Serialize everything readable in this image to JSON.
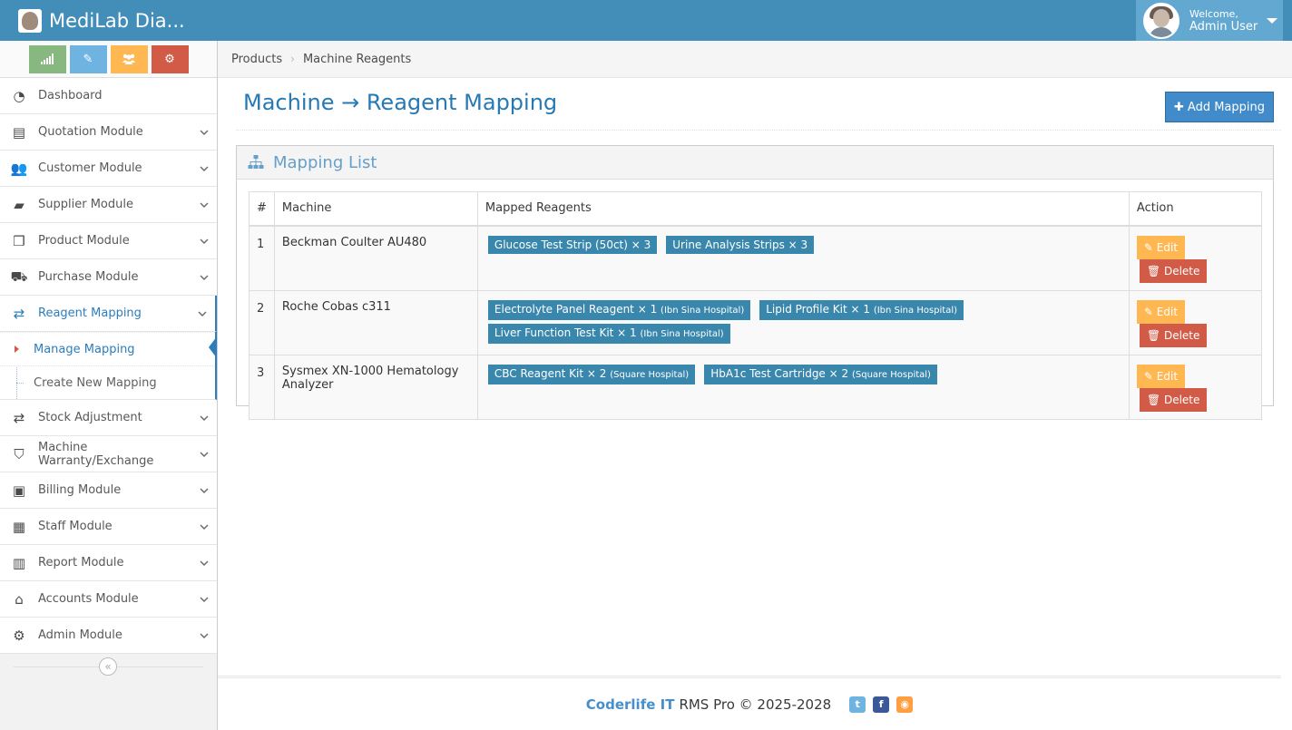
{
  "app": {
    "brand": "MediLab Dia..."
  },
  "user": {
    "welcome": "Welcome,",
    "name": "Admin User"
  },
  "colors": {
    "accent": "#438eb9",
    "link": "#2b7dbc",
    "badge": "#3a87ad",
    "edit": "#ffb752",
    "delete": "#d15b47"
  },
  "shortcuts": [
    "signal-icon",
    "pencil-icon",
    "users-icon",
    "cogs-icon"
  ],
  "sidebar": {
    "items": [
      {
        "label": "Dashboard",
        "icon": "tachometer-icon"
      },
      {
        "label": "Quotation Module",
        "icon": "file-text-icon"
      },
      {
        "label": "Customer Module",
        "icon": "users-icon"
      },
      {
        "label": "Supplier Module",
        "icon": "truck-icon"
      },
      {
        "label": "Product Module",
        "icon": "cubes-icon"
      },
      {
        "label": "Purchase Module",
        "icon": "cart-icon"
      },
      {
        "label": "Reagent Mapping",
        "icon": "exchange-icon"
      },
      {
        "label": "Stock Adjustment",
        "icon": "exchange-icon"
      },
      {
        "label": "Machine Warranty/Exchange",
        "icon": "shield-icon"
      },
      {
        "label": "Billing Module",
        "icon": "money-icon"
      },
      {
        "label": "Staff Module",
        "icon": "briefcase-icon"
      },
      {
        "label": "Report Module",
        "icon": "bar-chart-icon"
      },
      {
        "label": "Accounts Module",
        "icon": "bank-icon"
      },
      {
        "label": "Admin Module",
        "icon": "cog-icon"
      }
    ],
    "submenu": [
      {
        "label": "Manage Mapping"
      },
      {
        "label": "Create New Mapping"
      }
    ]
  },
  "breadcrumb": {
    "parent": "Products",
    "current": "Machine Reagents"
  },
  "page": {
    "title": "Machine → Reagent Mapping",
    "add_button": "Add Mapping"
  },
  "widget": {
    "title": "Mapping List"
  },
  "table": {
    "headers": [
      "#",
      "Machine",
      "Mapped Reagents",
      "Action"
    ],
    "rows": [
      {
        "num": "1",
        "machine": "Beckman Coulter AU480",
        "reagents": [
          {
            "name": "Glucose Test Strip (50ct) × 3",
            "hospital": ""
          },
          {
            "name": "Urine Analysis Strips × 3",
            "hospital": ""
          }
        ]
      },
      {
        "num": "2",
        "machine": "Roche Cobas c311",
        "reagents": [
          {
            "name": "Electrolyte Panel Reagent × 1",
            "hospital": "(Ibn Sina Hospital)"
          },
          {
            "name": "Lipid Profile Kit × 1",
            "hospital": "(Ibn Sina Hospital)"
          },
          {
            "name": "Liver Function Test Kit × 1",
            "hospital": "(Ibn Sina Hospital)"
          }
        ]
      },
      {
        "num": "3",
        "machine": "Sysmex XN-1000 Hematology Analyzer",
        "reagents": [
          {
            "name": "CBC Reagent Kit × 2",
            "hospital": "(Square Hospital)"
          },
          {
            "name": "HbA1c Test Cartridge × 2",
            "hospital": "(Square Hospital)"
          }
        ]
      }
    ],
    "edit_label": "Edit",
    "delete_label": "Delete"
  },
  "footer": {
    "brand": "Coderlife IT",
    "text": "RMS Pro © 2025-2028"
  }
}
